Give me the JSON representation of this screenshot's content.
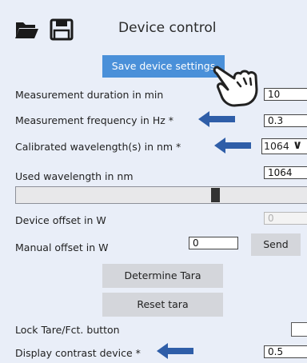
{
  "header": {
    "title": "Device control",
    "open_icon": "folder-open-icon",
    "save_icon": "floppy-disk-icon"
  },
  "save_button": {
    "label": "Save device settings"
  },
  "measurement_duration": {
    "label": "Measurement duration in min",
    "value": "10"
  },
  "measurement_frequency": {
    "label": "Measurement frequency in Hz *",
    "value": "0.3"
  },
  "calibrated_wavelengths": {
    "label": "Calibrated wavelength(s) in nm *",
    "selected": "1064"
  },
  "used_wavelength": {
    "label": "Used wavelength in nm",
    "value": "1064"
  },
  "device_offset": {
    "label": "Device offset in W",
    "value": "0"
  },
  "manual_offset": {
    "label": "Manual offset in W",
    "value": "0"
  },
  "send_button": {
    "label": "Send"
  },
  "determine_tara_button": {
    "label": "Determine Tara"
  },
  "reset_tara_button": {
    "label": "Reset tara"
  },
  "lock_tare": {
    "label": "Lock Tare/Fct. button"
  },
  "display_contrast": {
    "label": "Display contrast device *",
    "value": "0.5"
  },
  "colors": {
    "background": "#e9eef8",
    "accent_button": "#4a90d9",
    "arrow": "#2f5ea8",
    "gray_button": "#d4d6db"
  }
}
